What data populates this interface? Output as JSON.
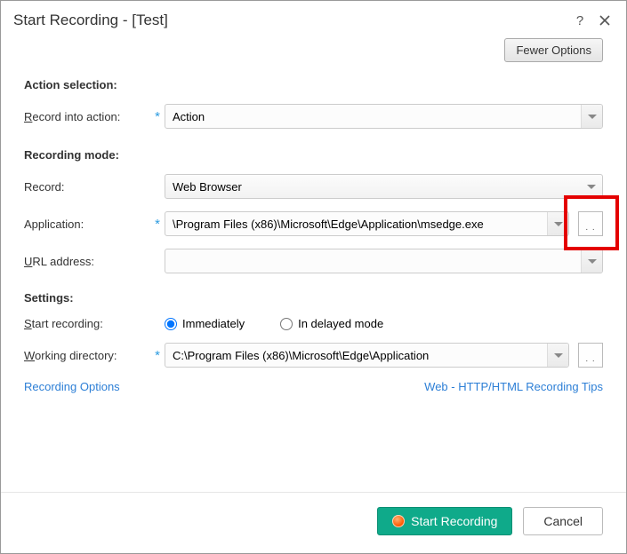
{
  "title": "Start Recording - [Test]",
  "options_button": "Fewer Options",
  "sections": {
    "action_selection": "Action selection:",
    "recording_mode": "Recording mode:",
    "settings": "Settings:"
  },
  "labels": {
    "record_into_action": "Record into action:",
    "record": "Record:",
    "application": "Application:",
    "url_address": "URL address:",
    "start_recording": "Start recording:",
    "working_directory": "Working directory:"
  },
  "values": {
    "action": "Action",
    "record_mode": "Web Browser",
    "application": "\\Program Files (x86)\\Microsoft\\Edge\\Application\\msedge.exe",
    "url_address": "",
    "working_directory": "C:\\Program Files (x86)\\Microsoft\\Edge\\Application"
  },
  "radios": {
    "immediately": "Immediately",
    "delayed": "In delayed mode"
  },
  "links": {
    "recording_options": "Recording Options",
    "tips": "Web - HTTP/HTML Recording Tips"
  },
  "buttons": {
    "start": "Start Recording",
    "cancel": "Cancel"
  }
}
